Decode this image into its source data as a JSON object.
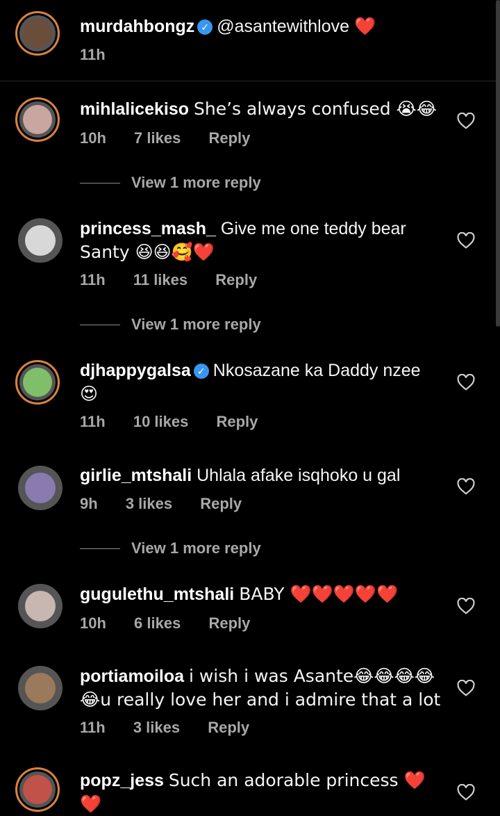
{
  "post": {
    "username": "murdahbongz",
    "verified": true,
    "caption": "@asantewithlove ❤️",
    "time": "11h",
    "avatar_color": "#6b4d3c"
  },
  "comments": [
    {
      "username": "mihlalicekiso",
      "verified": false,
      "text_line1": "She’s always confused 😭😂",
      "text_line2": "",
      "time": "10h",
      "likes": "7 likes",
      "reply": "Reply",
      "view_more": "View 1 more reply",
      "avatar_color": "#c9a6a0"
    },
    {
      "username": "princess_mash_",
      "verified": false,
      "text_line1": "Give me one teddy bear",
      "text_line2": "Santy 😆😆🥰❤️",
      "time": "11h",
      "likes": "11 likes",
      "reply": "Reply",
      "view_more": "View 1 more reply",
      "avatar_color": "#d8d8d8"
    },
    {
      "username": "djhappygalsa",
      "verified": true,
      "text_line1": "Nkosazane ka Daddy nzee",
      "text_line2": "😍",
      "time": "11h",
      "likes": "10 likes",
      "reply": "Reply",
      "view_more": "",
      "avatar_color": "#7fbf6a"
    },
    {
      "username": "girlie_mtshali",
      "verified": false,
      "text_line1": "Uhlala afake isqhoko u gal",
      "text_line2": "",
      "time": "9h",
      "likes": "3 likes",
      "reply": "Reply",
      "view_more": "View 1 more reply",
      "avatar_color": "#8a7ab0"
    },
    {
      "username": "gugulethu_mtshali",
      "verified": false,
      "text_line1": "BABY ❤️❤️❤️❤️❤️",
      "text_line2": "",
      "time": "10h",
      "likes": "6 likes",
      "reply": "Reply",
      "view_more": "",
      "avatar_color": "#c7b7b0"
    },
    {
      "username": "portiamoiloa",
      "verified": false,
      "text_line1": "i wish i was Asante😂😂😂😂",
      "text_line2": "😂u really love her and i admire that a lot",
      "time": "11h",
      "likes": "3 likes",
      "reply": "Reply",
      "view_more": "",
      "avatar_color": "#9a7a5a"
    },
    {
      "username": "popz_jess",
      "verified": false,
      "text_line1": "Such an adorable princess ❤️❤️",
      "text_line2": "",
      "time": "",
      "likes": "",
      "reply": "",
      "view_more": "",
      "avatar_color": "#c0524a"
    }
  ],
  "icons": {
    "heart": "heart-outline-icon",
    "verified": "verified-badge-icon"
  },
  "colors": {
    "background": "#000000",
    "meta_text": "#a8a8a8",
    "verified_blue": "#3797f0",
    "story_ring": "#d9823f"
  }
}
